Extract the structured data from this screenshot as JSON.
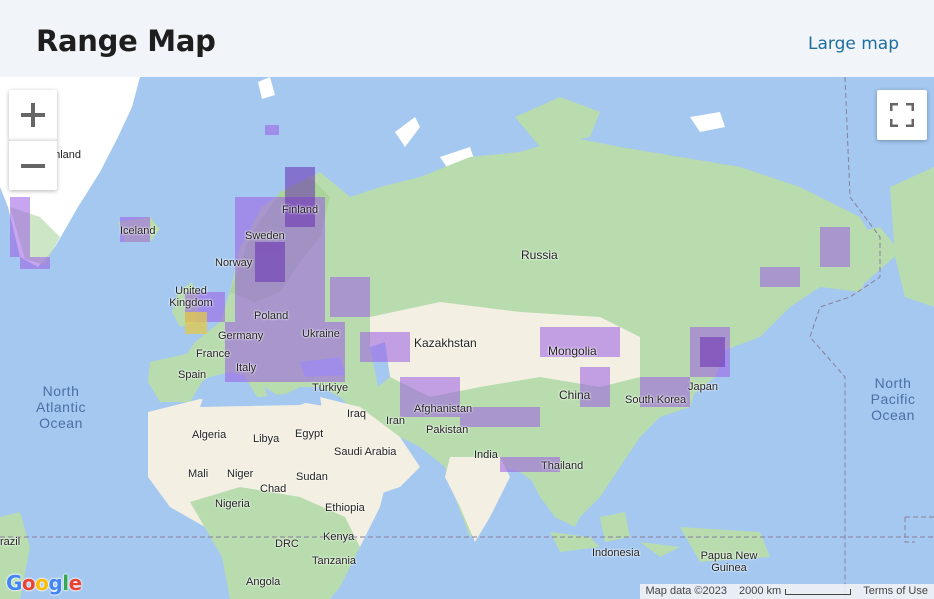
{
  "header": {
    "title": "Range Map",
    "large_map_link": "Large map"
  },
  "map": {
    "labels": {
      "greenland": "enland",
      "iceland": "Iceland",
      "finland": "Finland",
      "sweden": "Sweden",
      "norway": "Norway",
      "uk": "United Kingdom",
      "poland": "Poland",
      "germany": "Germany",
      "ukraine": "Ukraine",
      "france": "France",
      "italy": "Italy",
      "spain": "Spain",
      "turkiye": "Türkiye",
      "russia": "Russia",
      "kazakhstan": "Kazakhstan",
      "mongolia": "Mongolia",
      "china": "China",
      "south_korea": "South Korea",
      "japan": "Japan",
      "iraq": "Iraq",
      "iran": "Iran",
      "afghanistan": "Afghanistan",
      "pakistan": "Pakistan",
      "india": "India",
      "thailand": "Thailand",
      "indonesia": "Indonesia",
      "papua_new_guinea": "Papua New Guinea",
      "algeria": "Algeria",
      "libya": "Libya",
      "egypt": "Egypt",
      "saudi_arabia": "Saudi Arabia",
      "mali": "Mali",
      "niger": "Niger",
      "chad": "Chad",
      "sudan": "Sudan",
      "nigeria": "Nigeria",
      "ethiopia": "Ethiopia",
      "drc": "DRC",
      "kenya": "Kenya",
      "tanzania": "Tanzania",
      "angola": "Angola",
      "brazil": "razil",
      "north_atlantic": [
        "North",
        "Atlantic",
        "Ocean"
      ],
      "north_pacific": [
        "North",
        "Pacific",
        "Ocean"
      ]
    },
    "attribution": {
      "map_data": "Map data ©2023",
      "scale": "2000 km",
      "terms": "Terms of Use"
    },
    "logo": [
      "G",
      "o",
      "o",
      "g",
      "l",
      "e"
    ],
    "logo_colors": [
      "#4285f4",
      "#ea4335",
      "#fbbc05",
      "#4285f4",
      "#34a853",
      "#ea4335"
    ],
    "icons": {
      "zoom_in": "plus-icon",
      "zoom_out": "minus-icon",
      "fullscreen": "fullscreen-icon"
    },
    "colors": {
      "water": "#a4c8f0",
      "land_green": "#b8dcae",
      "land_desert": "#f3efe2",
      "ice": "#ffffff",
      "range": "#9b5de5"
    }
  }
}
